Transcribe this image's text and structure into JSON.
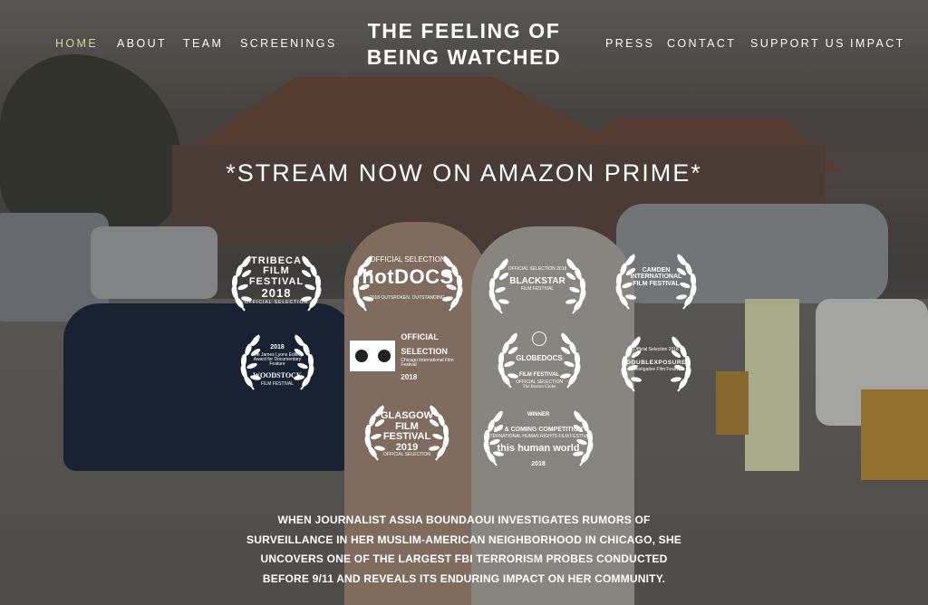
{
  "nav": {
    "left": [
      "HOME",
      "ABOUT",
      "TEAM",
      "SCREENINGS"
    ],
    "right": [
      "PRESS",
      "CONTACT",
      "SUPPORT US",
      "IMPACT"
    ],
    "active_color": "#d6d09a"
  },
  "site_title": {
    "line1": "THE FEELING OF",
    "line2": "BEING WATCHED"
  },
  "stream_banner": "*STREAM NOW ON AMAZON PRIME*",
  "laurels": {
    "tribeca": {
      "l1": "TRIBECA",
      "l2": "FILM",
      "l3": "FESTIVAL",
      "year": "2018",
      "note": "OFFICIAL SELECTION"
    },
    "hotdocs": {
      "top": "OFFICIAL SELECTION",
      "name": "hotDOCS",
      "sub": "2018   OUTSPOKEN. OUTSTANDING."
    },
    "blackstar": {
      "top": "OFFICIAL SELECTION 2018",
      "name": "BLACKSTAR",
      "sub": "FILM FESTIVAL"
    },
    "camden": {
      "l1": "CAMDEN",
      "l2": "INTERNATIONAL",
      "l3": "FILM FESTIVAL"
    },
    "woodstock": {
      "year": "2018",
      "note": "The James Lyons Editing Award for Documentary Feature",
      "name": "WOODSTOCK",
      "sub": "FILM FESTIVAL"
    },
    "chicago": {
      "l1": "OFFICIAL",
      "l2": "SELECTION",
      "l3": "Chicago International Film Festival",
      "year": "2018"
    },
    "globedocs": {
      "name": "GLOBEDOCS",
      "sub": "FILM FESTIVAL",
      "note": "OFFICIAL SELECTION",
      "paper": "The Boston Globe"
    },
    "doublexposure": {
      "top": "Official Selection 2018",
      "name": "DOUBLEXPOSURE",
      "sub": "Investigative Film Festival"
    },
    "glasgow": {
      "l1": "GLASGOW",
      "l2": "FILM",
      "l3": "FESTIVAL",
      "year": "2019",
      "note": "OFFICIAL SELECTION"
    },
    "thishumanworld": {
      "top": "WINNER",
      "award": "UP & COMING COMPETITION",
      "pre": "INTERNATIONAL HUMAN RIGHTS FILM FESTIVAL",
      "name": "this human world",
      "year": "2018"
    }
  },
  "description": "WHEN JOURNALIST ASSIA BOUNDAOUI INVESTIGATES RUMORS OF SURVEILLANCE IN HER MUSLIM-AMERICAN NEIGHBORHOOD IN CHICAGO, SHE UNCOVERS ONE OF THE LARGEST FBI TERRORISM PROBES CONDUCTED BEFORE 9/11 AND REVEALS ITS ENDURING IMPACT ON HER COMMUNITY."
}
